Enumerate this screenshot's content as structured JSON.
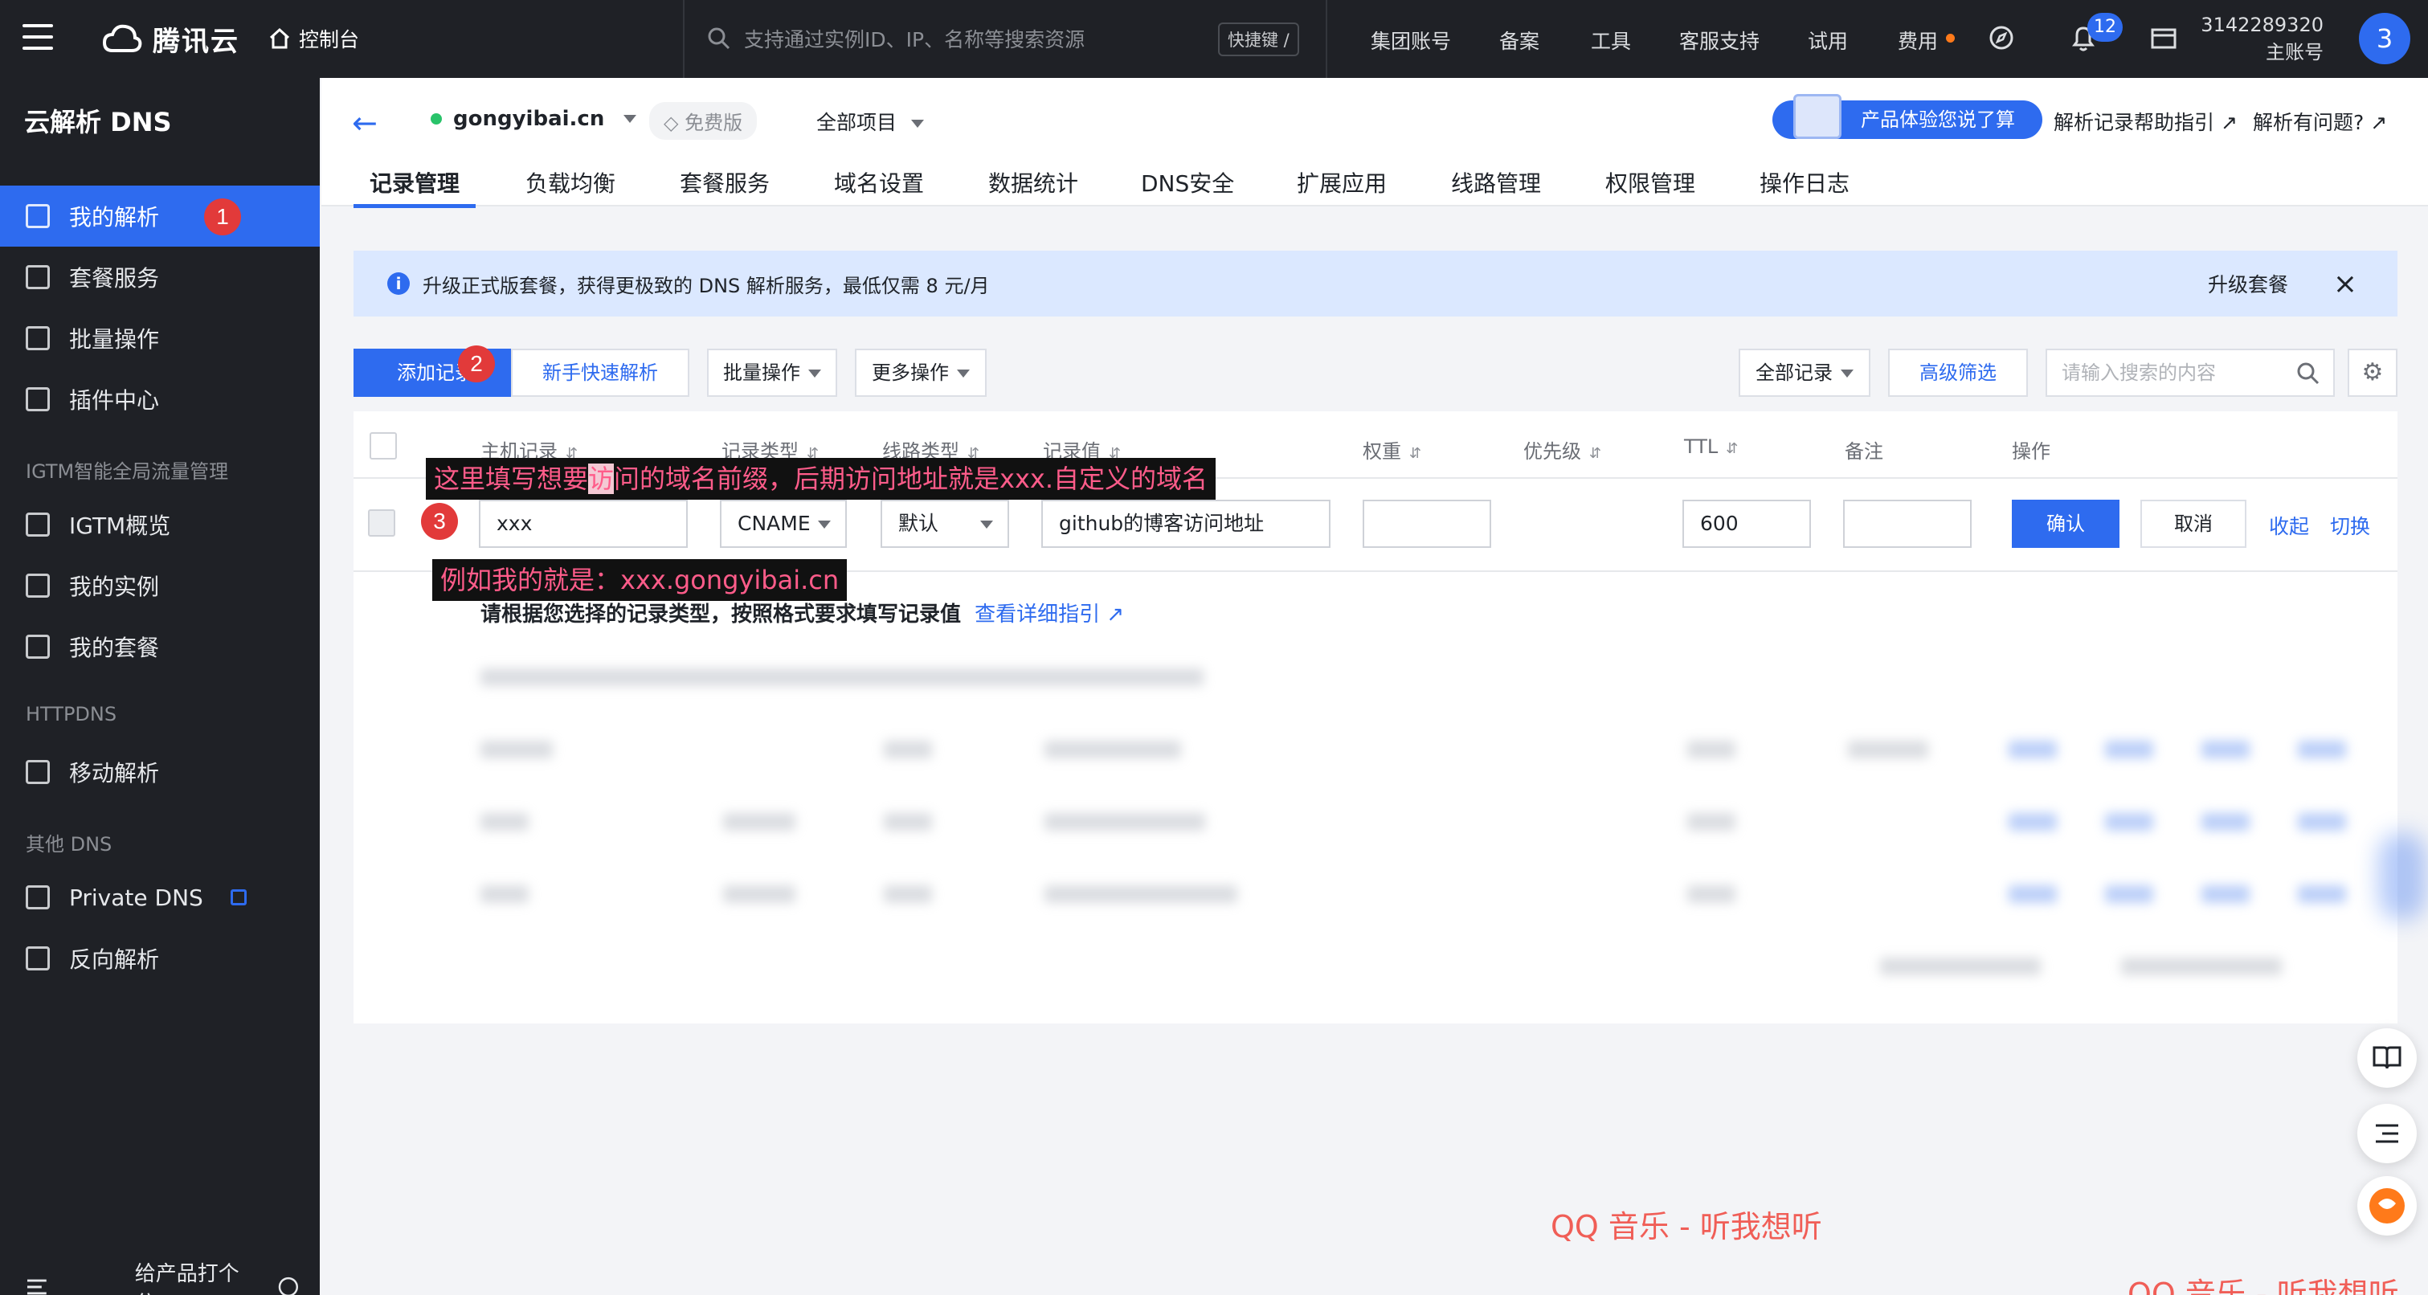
{
  "topbar": {
    "brand": "腾讯云",
    "console": "控制台",
    "search_placeholder": "支持通过实例ID、IP、名称等搜索资源",
    "hotkey": "快捷键 /",
    "nav": [
      "集团账号",
      "备案",
      "工具",
      "客服支持",
      "试用",
      "费用"
    ],
    "notification_count": "12",
    "account_id": "3142289320",
    "account_role": "主账号",
    "avatar_letter": "3"
  },
  "sidebar": {
    "title": "云解析 DNS",
    "items": [
      {
        "label": "我的解析",
        "icon": "w-doc-icon",
        "active": true
      },
      {
        "label": "套餐服务",
        "icon": "package-icon"
      },
      {
        "label": "批量操作",
        "icon": "batch-icon"
      },
      {
        "label": "插件中心",
        "icon": "plugin-icon"
      }
    ],
    "group_igtm": "IGTM智能全局流量管理",
    "igtm_items": [
      {
        "label": "IGTM概览",
        "icon": "grid-icon"
      },
      {
        "label": "我的实例",
        "icon": "instance-icon"
      },
      {
        "label": "我的套餐",
        "icon": "list-icon"
      }
    ],
    "group_httpdns": "HTTPDNS",
    "httpdns_items": [
      {
        "label": "移动解析",
        "icon": "mobile-dns-icon"
      }
    ],
    "group_other": "其他 DNS",
    "other_items": [
      {
        "label": "Private DNS",
        "icon": "diamond-icon",
        "external": true
      },
      {
        "label": "反向解析",
        "icon": "reverse-icon"
      }
    ],
    "footer": "给产品打个分"
  },
  "header": {
    "domain": "gongyibai.cn",
    "plan_badge": "免费版",
    "project": "全部项目",
    "feedback": "产品体验您说了算",
    "help_link": "解析记录帮助指引",
    "question_link": "解析有问题?",
    "tabs": [
      "记录管理",
      "负载均衡",
      "套餐服务",
      "域名设置",
      "数据统计",
      "DNS安全",
      "扩展应用",
      "线路管理",
      "权限管理",
      "操作日志"
    ]
  },
  "notice": {
    "text": "升级正式版套餐，获得更极致的 DNS 解析服务，最低仅需 8 元/月",
    "action": "升级套餐"
  },
  "toolbar": {
    "add": "添加记录",
    "quick": "新手快速解析",
    "batch": "批量操作",
    "more": "更多操作",
    "filter_all": "全部记录",
    "advanced": "高级筛选",
    "search_placeholder": "请输入搜索的内容"
  },
  "table": {
    "columns": [
      "主机记录",
      "记录类型",
      "线路类型",
      "记录值",
      "权重",
      "优先级",
      "TTL",
      "备注",
      "操作"
    ],
    "edit_row": {
      "host": "xxx",
      "type": "CNAME",
      "line": "默认",
      "value": "github的博客访问地址",
      "weight": "",
      "ttl": "600",
      "remark": "",
      "confirm": "确认",
      "cancel": "取消",
      "collapse": "收起",
      "switch": "切换"
    },
    "hint": "请根据您选择的记录类型，按照格式要求填写记录值",
    "hint_link": "查看详细指引"
  },
  "annotations": {
    "step1": "1",
    "step2": "2",
    "step3": "3",
    "note1_a": "这里填写想要",
    "note1_hl": "访",
    "note1_b": "问的域名前缀，后期访问地址就是xxx.自定义的域名",
    "note2": "例如我的就是：xxx.gongyibai.cn"
  },
  "watermarks": [
    "QQ 音乐 - 听我想听",
    "QQ 音乐 - 听我想听"
  ],
  "colors": {
    "primary": "#2e6bef",
    "dark": "#1f2126",
    "annotation": "#ff5c8a",
    "step_badge": "#e23a3a"
  }
}
